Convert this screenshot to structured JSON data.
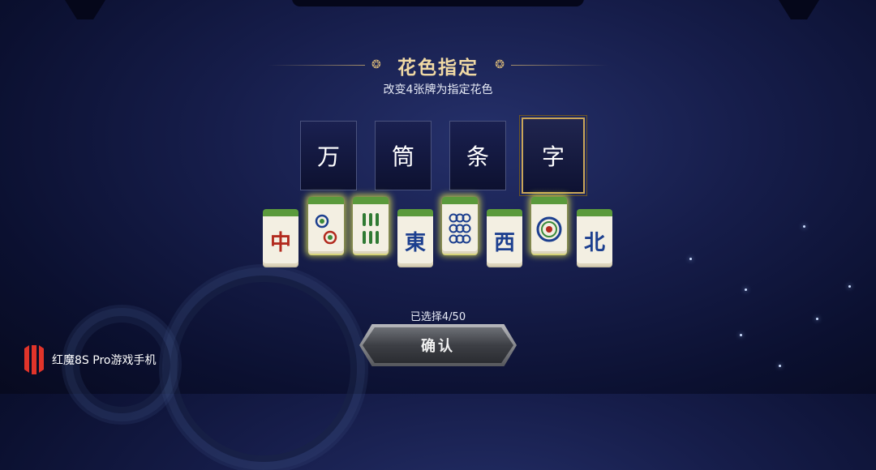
{
  "dialog": {
    "title": "花色指定",
    "subtitle": "改变4张牌为指定花色",
    "title_ornament": "❂"
  },
  "suits": [
    {
      "label": "万",
      "selected": false
    },
    {
      "label": "筒",
      "selected": false
    },
    {
      "label": "条",
      "selected": false
    },
    {
      "label": "字",
      "selected": true
    }
  ],
  "tiles": [
    {
      "face": "中",
      "color": "#b22a1e",
      "selected": false
    },
    {
      "face": "two-circles",
      "selected": true
    },
    {
      "face": "six-bamboo",
      "selected": true
    },
    {
      "face": "東",
      "color": "#1c3f8f",
      "selected": false
    },
    {
      "face": "nine-circles",
      "selected": true
    },
    {
      "face": "西",
      "color": "#1c3f8f",
      "selected": false
    },
    {
      "face": "one-circle",
      "selected": true
    },
    {
      "face": "北",
      "color": "#1c3f8f",
      "selected": false
    }
  ],
  "selection": {
    "count_text": "已选择4/50"
  },
  "confirm": {
    "label": "确认"
  },
  "watermark": {
    "text": "红魔8S Pro游戏手机"
  },
  "colors": {
    "accent_gold": "#c9a559",
    "tile_green": "#5b9a3c",
    "selection_glow": "#e1e650"
  }
}
